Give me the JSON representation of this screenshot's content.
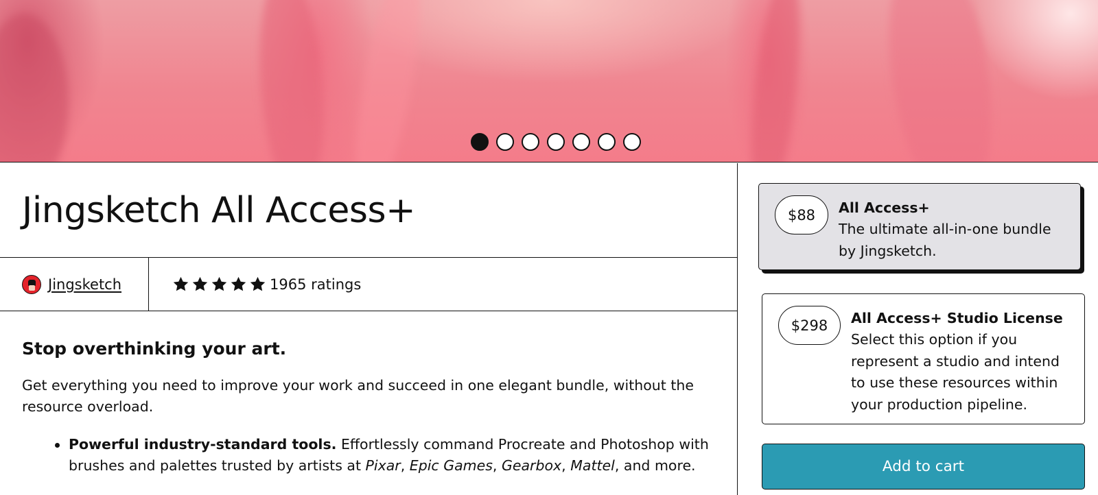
{
  "carousel": {
    "slide_count": 7,
    "active_index": 0
  },
  "product": {
    "title": "Jingsketch All Access+",
    "creator_name": "Jingsketch",
    "rating_stars": 5,
    "ratings_text": "1965 ratings"
  },
  "description": {
    "heading": "Stop overthinking your art.",
    "intro": "Get everything you need to improve your work and succeed in one elegant bundle, without the resource overload.",
    "bullet1": {
      "bold": "Powerful industry-standard tools.",
      "text1": " Effortlessly command Procreate and Photoshop with brushes and palettes trusted by artists at ",
      "brand1": "Pixar",
      "sep1": ", ",
      "brand2": "Epic Games",
      "sep2": ", ",
      "brand3": "Gearbox",
      "sep3": ", ",
      "brand4": "Mattel",
      "text2": ", and more."
    }
  },
  "options": [
    {
      "price": "$88",
      "title": "All Access+",
      "description": "The ultimate all-in-one bundle by Jingsketch.",
      "selected": true
    },
    {
      "price": "$298",
      "title": "All Access+ Studio License",
      "description": "Select this option if you represent a studio and intend to use these resources within your production pipeline.",
      "selected": false
    }
  ],
  "cart": {
    "button_label": "Add to cart"
  },
  "colors": {
    "accent_teal": "#2b9bb3",
    "selected_option_bg": "#e3e2e6",
    "hero_pink": "#f08590"
  }
}
